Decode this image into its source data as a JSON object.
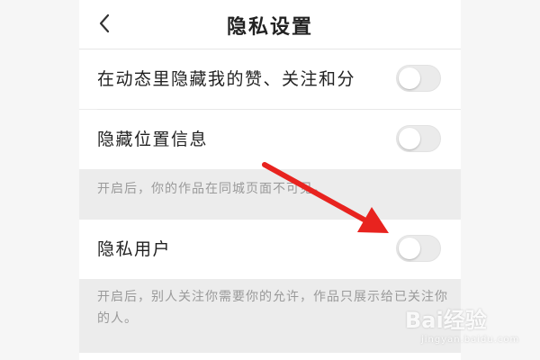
{
  "header": {
    "title": "隐私设置",
    "back_icon": "chevron-left-icon"
  },
  "settings": [
    {
      "label": "在动态里隐藏我的赞、关注和分",
      "enabled": false
    },
    {
      "label": "隐藏位置信息",
      "enabled": false
    },
    {
      "label": "隐私用户",
      "enabled": false
    }
  ],
  "hints": {
    "location": "开启后，你的作品在同城页面不可见。",
    "private_user": "开启后，别人关注你需要你的允许，作品只展示给已关注你的人。"
  },
  "watermark": {
    "text": "Bai经验",
    "sub": "jingyan.baidu.com"
  },
  "colors": {
    "arrow": "#e8231f",
    "toggle_off": "#ebebeb",
    "hint_text": "#9a9a9a"
  }
}
